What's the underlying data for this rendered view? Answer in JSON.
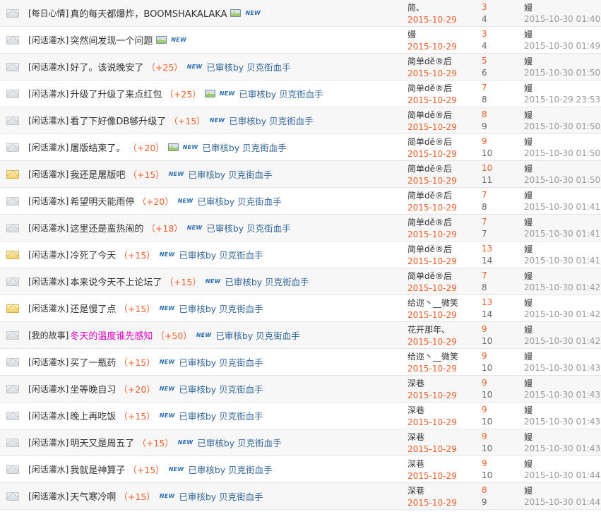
{
  "rows": [
    {
      "category": "[每日心情]",
      "title": "真的每天都爆炸，BOOMSHAKALAKA",
      "reward": "",
      "image": true,
      "new_label": "NEW",
      "audit": "",
      "author": "简、",
      "date": "2015-10-29",
      "replies": "3",
      "views": "4",
      "last_user": "嫚",
      "last_time": "2015-10-30 01:40",
      "icon": "envelope-icon",
      "pink": false
    },
    {
      "category": "[闲话灌水]",
      "title": "突然间发现一个问题",
      "reward": "",
      "image": true,
      "new_label": "NEW",
      "audit": "",
      "author": "嫚",
      "date": "2015-10-29",
      "replies": "3",
      "views": "4",
      "last_user": "嫚",
      "last_time": "2015-10-30 01:49",
      "icon": "envelope-icon",
      "pink": false
    },
    {
      "category": "[闲话灌水]",
      "title": "好了。该说晚安了",
      "reward": "（+25）",
      "image": false,
      "new_label": "NEW",
      "audit": "已审核by 贝克街血手",
      "author": "简单dě®后",
      "date": "2015-10-29",
      "replies": "5",
      "views": "6",
      "last_user": "嫚",
      "last_time": "2015-10-30 01:50",
      "icon": "envelope-icon",
      "pink": false
    },
    {
      "category": "[闲话灌水]",
      "title": "升级了升级了来点红包",
      "reward": "（+25）",
      "image": true,
      "new_label": "NEW",
      "audit": "已审核by 贝克街血手",
      "author": "简单dě®后",
      "date": "2015-10-29",
      "replies": "7",
      "views": "8",
      "last_user": "嫚",
      "last_time": "2015-10-29 23:53",
      "icon": "envelope-icon",
      "pink": false
    },
    {
      "category": "[闲话灌水]",
      "title": "看了下好像DB够升级了",
      "reward": "（+15）",
      "image": false,
      "new_label": "NEW",
      "audit": "已审核by 贝克街血手",
      "author": "简单dě®后",
      "date": "2015-10-29",
      "replies": "8",
      "views": "9",
      "last_user": "嫚",
      "last_time": "2015-10-30 01:50",
      "icon": "envelope-icon",
      "pink": false
    },
    {
      "category": "[闲话灌水]",
      "title": "屠版结束了。",
      "reward": "（+20）",
      "image": true,
      "new_label": "NEW",
      "audit": "已审核by 贝克街血手",
      "author": "简单dě®后",
      "date": "2015-10-29",
      "replies": "9",
      "views": "10",
      "last_user": "嫚",
      "last_time": "2015-10-30 01:50",
      "icon": "envelope-icon",
      "pink": false
    },
    {
      "category": "[闲话灌水]",
      "title": "我还是屠版吧",
      "reward": "（+15）",
      "image": false,
      "new_label": "NEW",
      "audit": "已审核by 贝克街血手",
      "author": "简单dě®后",
      "date": "2015-10-29",
      "replies": "10",
      "views": "11",
      "last_user": "嫚",
      "last_time": "2015-10-30 01:50",
      "icon": "hot-envelope-icon",
      "pink": false
    },
    {
      "category": "[闲话灌水]",
      "title": "希望明天能雨停",
      "reward": "（+20）",
      "image": false,
      "new_label": "NEW",
      "audit": "已审核by 贝克街血手",
      "author": "简单dě®后",
      "date": "2015-10-29",
      "replies": "7",
      "views": "8",
      "last_user": "嫚",
      "last_time": "2015-10-30 01:41",
      "icon": "envelope-icon",
      "pink": false
    },
    {
      "category": "[闲话灌水]",
      "title": "这里还是蛮热闹的",
      "reward": "（+18）",
      "image": false,
      "new_label": "NEW",
      "audit": "已审核by 贝克街血手",
      "author": "简单dě®后",
      "date": "2015-10-29",
      "replies": "7",
      "views": "7",
      "last_user": "嫚",
      "last_time": "2015-10-30 01:41",
      "icon": "envelope-icon",
      "pink": false
    },
    {
      "category": "[闲话灌水]",
      "title": "冷死了今天",
      "reward": "（+15）",
      "image": false,
      "new_label": "NEW",
      "audit": "已审核by 贝克街血手",
      "author": "简单dě®后",
      "date": "2015-10-29",
      "replies": "13",
      "views": "14",
      "last_user": "嫚",
      "last_time": "2015-10-30 01:41",
      "icon": "hot-envelope-icon",
      "pink": false
    },
    {
      "category": "[闲话灌水]",
      "title": "本来说今天不上论坛了",
      "reward": "（+15）",
      "image": false,
      "new_label": "NEW",
      "audit": "已审核by 贝克街血手",
      "author": "简单dě®后",
      "date": "2015-10-29",
      "replies": "7",
      "views": "8",
      "last_user": "嫚",
      "last_time": "2015-10-30 01:42",
      "icon": "envelope-icon",
      "pink": false
    },
    {
      "category": "[闲话灌水]",
      "title": "还是慢了点",
      "reward": "（+15）",
      "image": false,
      "new_label": "NEW",
      "audit": "已审核by 贝克街血手",
      "author": "给迩丶__微笑",
      "date": "2015-10-29",
      "replies": "13",
      "views": "14",
      "last_user": "嫚",
      "last_time": "2015-10-30 01:42",
      "icon": "hot-envelope-icon",
      "pink": false
    },
    {
      "category": "[我的故事]",
      "title": "冬天的温度谁先感知",
      "reward": "（+50）",
      "image": false,
      "new_label": "NEW",
      "audit": "已审核by 贝克街血手",
      "author": "花开那年、",
      "date": "2015-10-29",
      "replies": "9",
      "views": "10",
      "last_user": "嫚",
      "last_time": "2015-10-30 01:42",
      "icon": "envelope-icon",
      "pink": true
    },
    {
      "category": "[闲话灌水]",
      "title": "买了一瓶药",
      "reward": "（+15）",
      "image": false,
      "new_label": "NEW",
      "audit": "已审核by 贝克街血手",
      "author": "给迩丶__微笑",
      "date": "2015-10-29",
      "replies": "9",
      "views": "10",
      "last_user": "嫚",
      "last_time": "2015-10-30 01:43",
      "icon": "envelope-icon",
      "pink": false
    },
    {
      "category": "[闲话灌水]",
      "title": "坐等晚自习",
      "reward": "（+20）",
      "image": false,
      "new_label": "NEW",
      "audit": "已审核by 贝克街血手",
      "author": "深巷",
      "date": "2015-10-29",
      "replies": "9",
      "views": "10",
      "last_user": "嫚",
      "last_time": "2015-10-30 01:43",
      "icon": "envelope-icon",
      "pink": false
    },
    {
      "category": "[闲话灌水]",
      "title": "晚上再吃饭",
      "reward": "（+15）",
      "image": false,
      "new_label": "NEW",
      "audit": "已审核by 贝克街血手",
      "author": "深巷",
      "date": "2015-10-29",
      "replies": "9",
      "views": "10",
      "last_user": "嫚",
      "last_time": "2015-10-30 01:43",
      "icon": "envelope-icon",
      "pink": false
    },
    {
      "category": "[闲话灌水]",
      "title": "明天又是周五了",
      "reward": "（+15）",
      "image": false,
      "new_label": "NEW",
      "audit": "已审核by 贝克街血手",
      "author": "深巷",
      "date": "2015-10-29",
      "replies": "9",
      "views": "10",
      "last_user": "嫚",
      "last_time": "2015-10-30 01:43",
      "icon": "envelope-icon",
      "pink": false
    },
    {
      "category": "[闲话灌水]",
      "title": "我就是神算子",
      "reward": "（+15）",
      "image": false,
      "new_label": "NEW",
      "audit": "已审核by 贝克街血手",
      "author": "深巷",
      "date": "2015-10-29",
      "replies": "9",
      "views": "10",
      "last_user": "嫚",
      "last_time": "2015-10-30 01:44",
      "icon": "envelope-icon",
      "pink": false
    },
    {
      "category": "[闲话灌水]",
      "title": "天气寒冷啊",
      "reward": "（+15）",
      "image": false,
      "new_label": "NEW",
      "audit": "已审核by 贝克街血手",
      "author": "深巷",
      "date": "2015-10-29",
      "replies": "8",
      "views": "9",
      "last_user": "嫚",
      "last_time": "2015-10-30 01:44",
      "icon": "envelope-icon",
      "pink": false
    }
  ],
  "colors": {
    "accent_orange": "#f2612d",
    "link_blue": "#336699",
    "highlight_pink": "#e000c0",
    "row_alt": "#f7f7f7",
    "border": "#e6e6e6"
  }
}
